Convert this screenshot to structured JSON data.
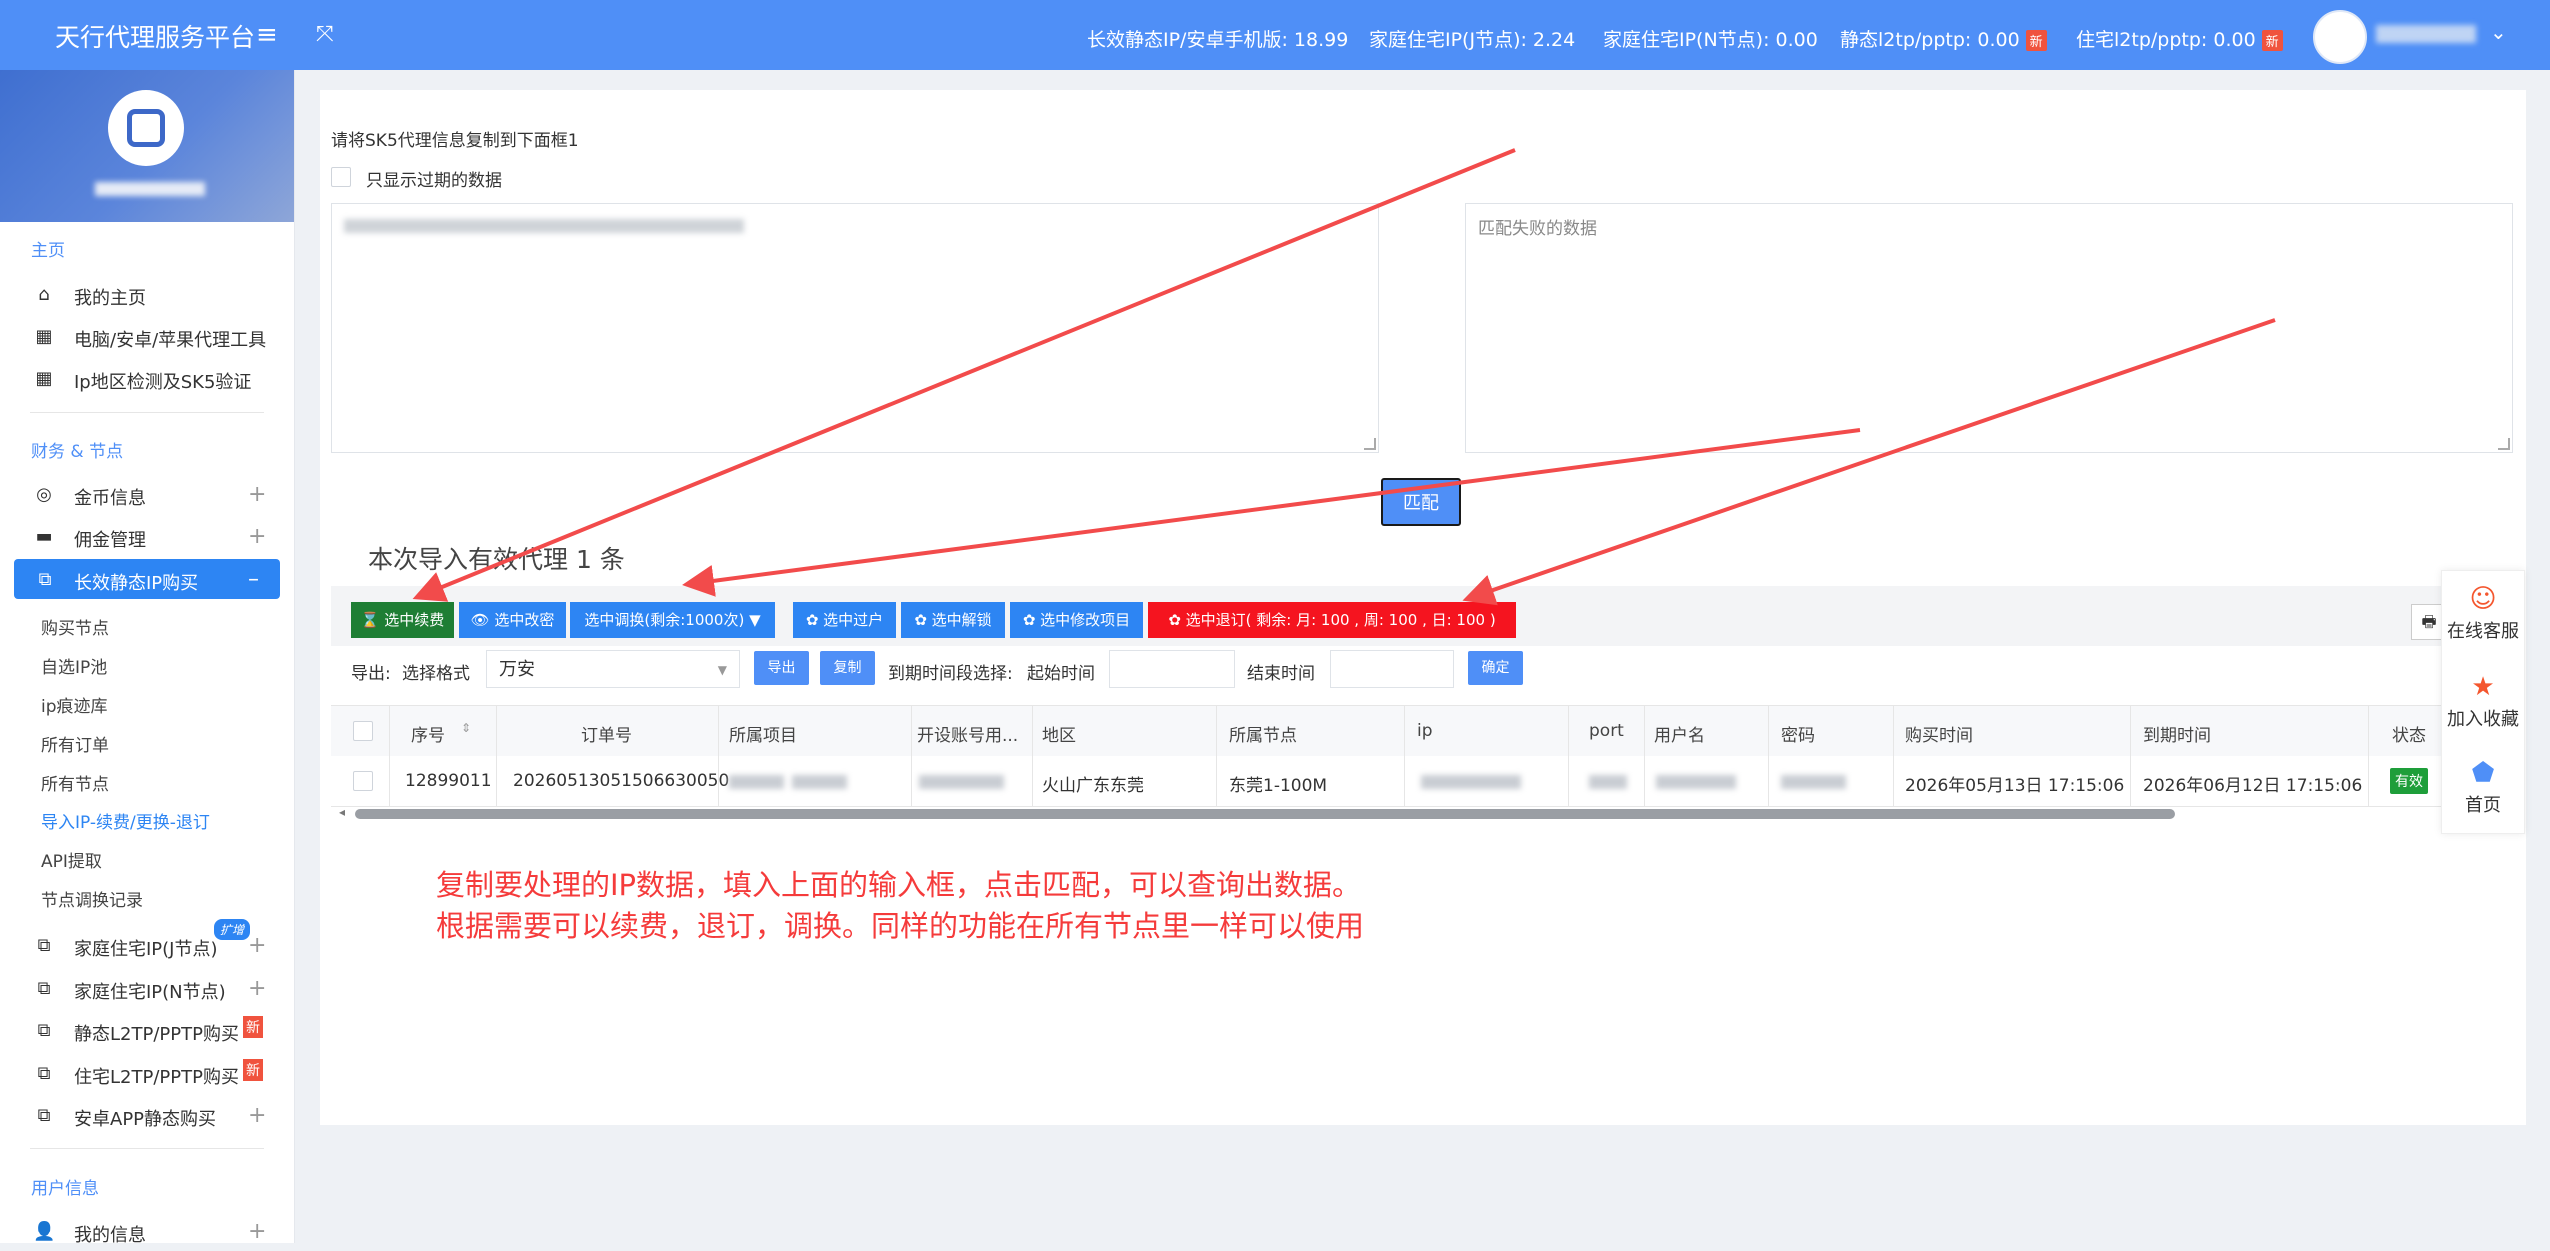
{
  "header": {
    "brand": "天行代理服务平台",
    "stats": [
      {
        "label": "长效静态IP/安卓手机版: 18.99",
        "new": ""
      },
      {
        "label": "家庭住宅IP(J节点): 2.24",
        "new": ""
      },
      {
        "label": "家庭住宅IP(N节点): 0.00",
        "new": ""
      },
      {
        "label": "静态l2tp/pptp: 0.00",
        "new": "新"
      },
      {
        "label": "住宅l2tp/pptp: 0.00",
        "new": "新"
      }
    ],
    "menu_icon": "hamburger-icon",
    "fullscreen_icon": "fullscreen-icon"
  },
  "sidebar": {
    "sections": {
      "home": "主页",
      "finance": "财务 & 节点",
      "user": "用户信息"
    },
    "home_items": [
      {
        "label": "我的主页",
        "icon": "home-icon"
      },
      {
        "label": "电脑/安卓/苹果代理工具",
        "icon": "grid-icon"
      },
      {
        "label": "Ip地区检测及SK5验证",
        "icon": "grid-icon"
      }
    ],
    "finance_items": [
      {
        "label": "金币信息",
        "icon": "coin-icon"
      },
      {
        "label": "佣金管理",
        "icon": "card-icon"
      },
      {
        "label": "长效静态IP购买",
        "icon": "nodes-icon"
      }
    ],
    "sub_items": [
      "购买节点",
      "自选IP池",
      "ip痕迹库",
      "所有订单",
      "所有节点",
      "导入IP-续费/更换-退订",
      "API提取",
      "节点调换记录"
    ],
    "more_items": [
      {
        "label": "家庭住宅IP(J节点)",
        "badge": "扩增"
      },
      {
        "label": "家庭住宅IP(N节点)",
        "badge": ""
      },
      {
        "label": "静态L2TP/PPTP购买",
        "badge": "新"
      },
      {
        "label": "住宅L2TP/PPTP购买",
        "badge": "新"
      },
      {
        "label": "安卓APP静态购买",
        "badge": ""
      }
    ],
    "user_items": [
      {
        "label": "我的信息"
      }
    ],
    "plus": "+",
    "minus": "–"
  },
  "main": {
    "instruction": "请将SK5代理信息复制到下面框1",
    "only_expired": "只显示过期的数据",
    "failed_placeholder": "匹配失败的数据",
    "match_button": "匹配",
    "valid_count": "本次导入有效代理 1 条",
    "actions": {
      "renew": "⌛ 选中续费",
      "modify": "👁 选中改密",
      "swap": "选中调换(剩余:1000次) ▼",
      "expire": "✿ 选中过户",
      "unlock": "✿ 选中解锁",
      "edit_project": "✿ 选中修改项目",
      "refund": "✿ 选中退订( 剩余:  月:  100 , 周:  100 , 日:  100 )"
    },
    "export_label": "导出:",
    "format_label": "选择格式",
    "format_value": "万安",
    "export_btn": "导出",
    "copy_btn": "复制",
    "expiry_label": "到期时间段选择:",
    "start_label": "起始时间",
    "end_label": "结束时间",
    "confirm_btn": "确定",
    "table": {
      "headers": [
        "序号",
        "订单号",
        "所属项目",
        "开设账号用...",
        "地区",
        "所属节点",
        "ip",
        "port",
        "用户名",
        "密码",
        "购买时间",
        "到期时间",
        "状态"
      ],
      "rows": [
        {
          "id": "12899011",
          "order": "20260513051506630050",
          "region": "火山广东东莞",
          "node": "东莞1-100M",
          "buy_time": "2026年05月13日 17:15:06",
          "expire_time": "2026年06月12日 17:15:06",
          "status": "有效"
        }
      ]
    },
    "note_line1": "复制要处理的IP数据，填入上面的输入框，点击匹配，可以查询出数据。",
    "note_line2": "根据需要可以续费，退订，调换。同样的功能在所有节点里一样可以使用"
  },
  "float_panel": {
    "items": [
      {
        "label": "在线客服",
        "icon": "support-icon"
      },
      {
        "label": "加入收藏",
        "icon": "star-icon"
      },
      {
        "label": "首页",
        "icon": "home-icon"
      }
    ]
  },
  "colors": {
    "header": "#4f8ff7",
    "active_nav": "#2d85f3",
    "green": "#1e7e34",
    "red": "#f5141f",
    "arrow": "#f24b4b"
  }
}
